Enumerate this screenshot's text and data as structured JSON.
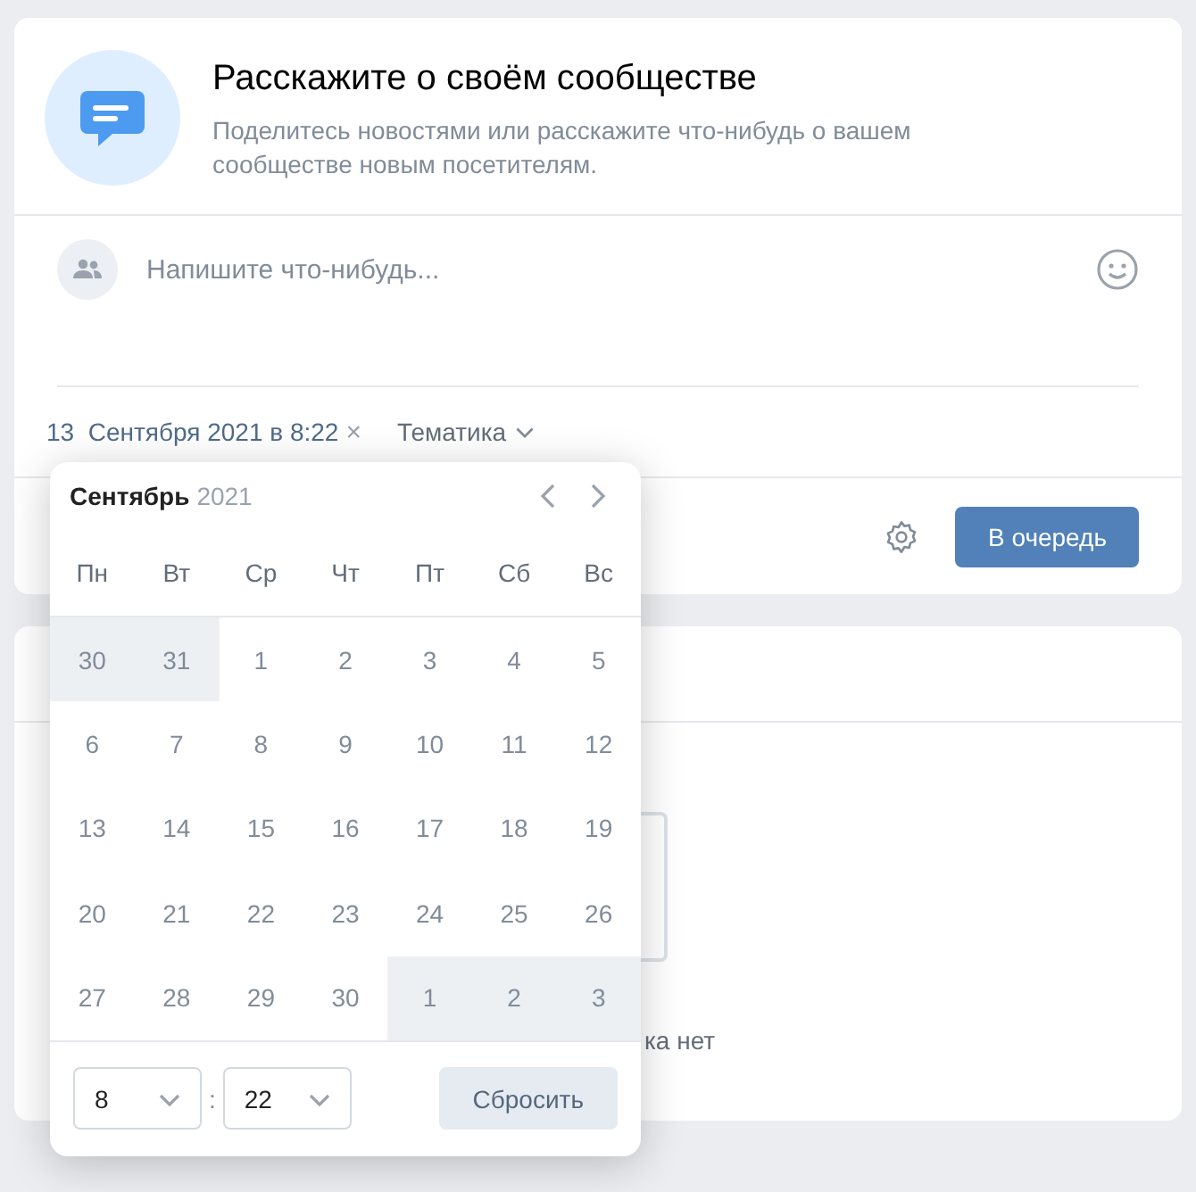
{
  "intro": {
    "title": "Расскажите о своём сообществе",
    "text": "Поделитесь новостями или расскажите что-нибудь о вашем сообществе новым посетителям."
  },
  "composer": {
    "placeholder": "Напишите что-нибудь..."
  },
  "meta": {
    "date": "13  Сентября 2021 в 8:22",
    "remove": "×",
    "topic": "Тематика"
  },
  "footer": {
    "submit": "В очередь"
  },
  "second_card": {
    "text": "ка нет"
  },
  "calendar": {
    "month": "Сентябрь",
    "year": "2021",
    "weekdays": [
      "Пн",
      "Вт",
      "Ср",
      "Чт",
      "Пт",
      "Сб",
      "Вс"
    ],
    "weeks": [
      [
        {
          "label": "30",
          "outside": true
        },
        {
          "label": "31",
          "outside": true
        },
        {
          "label": "1",
          "outside": false
        },
        {
          "label": "2",
          "outside": false
        },
        {
          "label": "3",
          "outside": false
        },
        {
          "label": "4",
          "outside": false
        },
        {
          "label": "5",
          "outside": false
        }
      ],
      [
        {
          "label": "6",
          "outside": false
        },
        {
          "label": "7",
          "outside": false
        },
        {
          "label": "8",
          "outside": false
        },
        {
          "label": "9",
          "outside": false
        },
        {
          "label": "10",
          "outside": false
        },
        {
          "label": "11",
          "outside": false
        },
        {
          "label": "12",
          "outside": false
        }
      ],
      [
        {
          "label": "13",
          "outside": false
        },
        {
          "label": "14",
          "outside": false
        },
        {
          "label": "15",
          "outside": false
        },
        {
          "label": "16",
          "outside": false
        },
        {
          "label": "17",
          "outside": false
        },
        {
          "label": "18",
          "outside": false
        },
        {
          "label": "19",
          "outside": false
        }
      ],
      [
        {
          "label": "20",
          "outside": false
        },
        {
          "label": "21",
          "outside": false
        },
        {
          "label": "22",
          "outside": false
        },
        {
          "label": "23",
          "outside": false
        },
        {
          "label": "24",
          "outside": false
        },
        {
          "label": "25",
          "outside": false
        },
        {
          "label": "26",
          "outside": false
        }
      ],
      [
        {
          "label": "27",
          "outside": false
        },
        {
          "label": "28",
          "outside": false
        },
        {
          "label": "29",
          "outside": false
        },
        {
          "label": "30",
          "outside": false
        },
        {
          "label": "1",
          "outside": true
        },
        {
          "label": "2",
          "outside": true
        },
        {
          "label": "3",
          "outside": true
        }
      ]
    ],
    "hour": "8",
    "separator": ":",
    "minute": "22",
    "reset": "Сбросить"
  }
}
